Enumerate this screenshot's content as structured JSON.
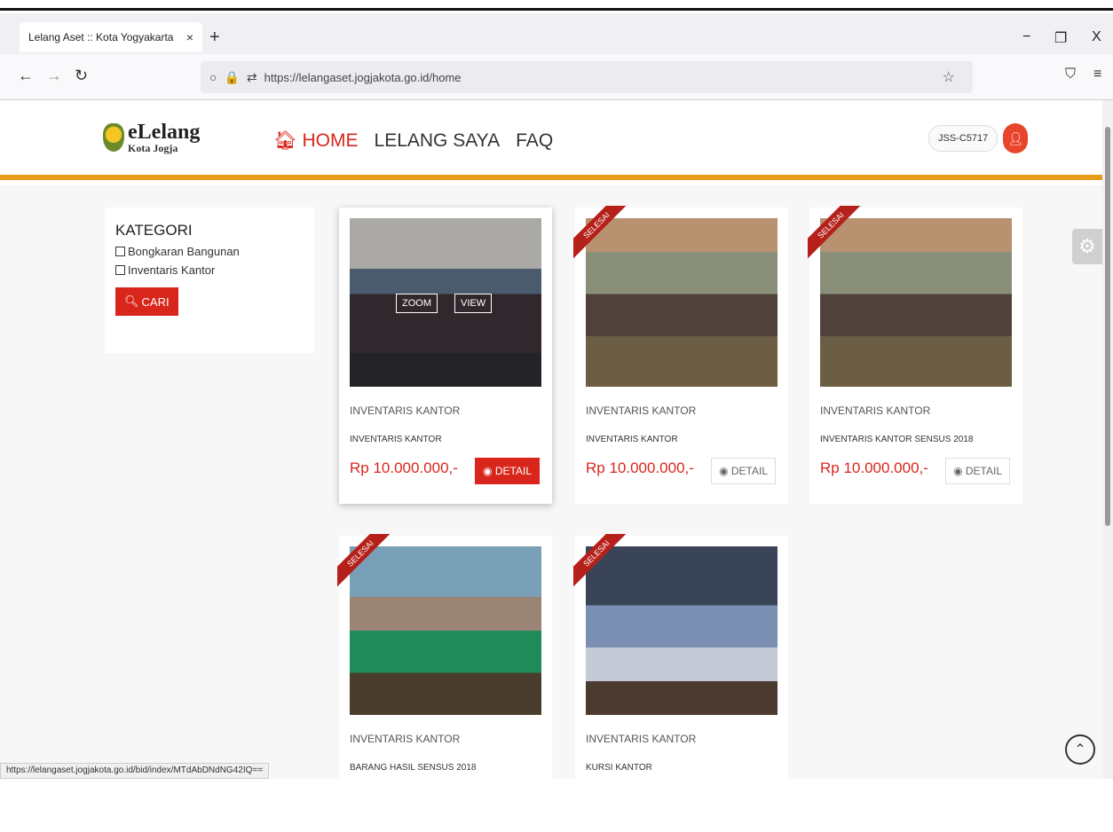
{
  "browser": {
    "tab_title": "Lelang Aset :: Kota Yogyakarta",
    "tab_close": "×",
    "new_tab": "+",
    "url": "https://lelangaset.jogjakota.go.id/home",
    "minimize": "−",
    "restore": "❐",
    "close": "X",
    "status_url": "https://lelangaset.jogjakota.go.id/bid/index/MTdAbDNdNG42IQ=="
  },
  "header": {
    "logo_title": "eLelang",
    "logo_sub": "Kota Jogja",
    "nav": [
      {
        "label": "HOME",
        "icon": "home-icon"
      },
      {
        "label": "LELANG SAYA"
      },
      {
        "label": "FAQ"
      }
    ],
    "user_code": "JSS-C5717"
  },
  "sidebar": {
    "title": "KATEGORI",
    "options": [
      "Bongkaran Bangunan",
      "Inventaris Kantor"
    ],
    "search_button": "CARI"
  },
  "cards": [
    {
      "category": "INVENTARIS KANTOR",
      "title": "INVENTARIS KANTOR",
      "price": "Rp 10.000.000,-",
      "detail_label": "DETAIL",
      "ribbon": "",
      "overlay_zoom": "ZOOM",
      "overlay_view": "VIEW"
    },
    {
      "category": "INVENTARIS KANTOR",
      "title": "INVENTARIS KANTOR",
      "price": "Rp 10.000.000,-",
      "detail_label": "DETAIL",
      "ribbon": "SELESAI"
    },
    {
      "category": "INVENTARIS KANTOR",
      "title": "INVENTARIS KANTOR SENSUS 2018",
      "price": "Rp 10.000.000,-",
      "detail_label": "DETAIL",
      "ribbon": "SELESAI"
    },
    {
      "category": "INVENTARIS KANTOR",
      "title": "BARANG HASIL SENSUS 2018",
      "price": "",
      "detail_label": "",
      "ribbon": "SELESAI"
    },
    {
      "category": "INVENTARIS KANTOR",
      "title": "KURSI KANTOR",
      "price": "",
      "detail_label": "",
      "ribbon": "SELESAI"
    }
  ],
  "colors": {
    "accent": "#d9261c",
    "header_border": "#e89a1a"
  }
}
